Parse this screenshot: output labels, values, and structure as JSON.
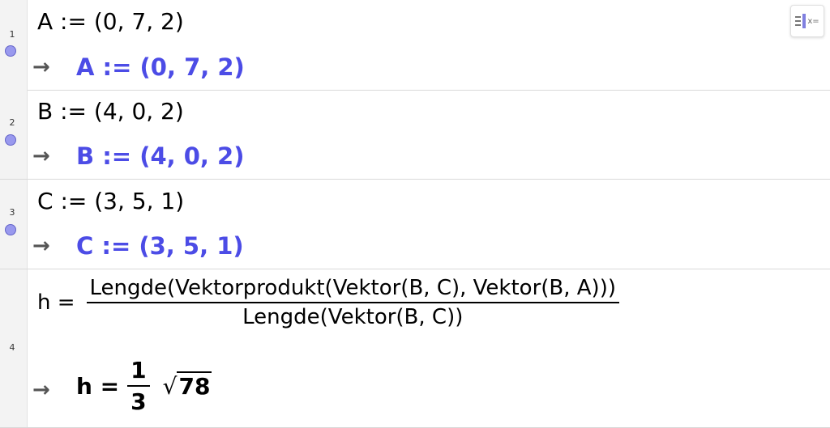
{
  "rows": [
    {
      "number": "1",
      "input": "A := (0, 7, 2)",
      "arrow": "→",
      "output": "A := (0, 7, 2)"
    },
    {
      "number": "2",
      "input": "B := (4, 0, 2)",
      "arrow": "→",
      "output": "B := (4, 0, 2)"
    },
    {
      "number": "3",
      "input": "C := (3, 5, 1)",
      "arrow": "→",
      "output": "C := (3, 5, 1)"
    },
    {
      "number": "4",
      "input_lhs": "h =",
      "input_numerator": "Lengde(Vektorprodukt(Vektor(B, C), Vektor(B, A)))",
      "input_denominator": "Lengde(Vektor(B, C))",
      "arrow": "→",
      "output_lhs": "h =",
      "output_numerator": "1",
      "output_denominator": "3",
      "output_sqrt_symbol": "√",
      "output_radicand": "78"
    }
  ],
  "colors": {
    "output_accent": "#4c4ce6",
    "toggle": "#9999ee"
  },
  "toolbar": {
    "algebra_toggle_icon": "algebra-view-icon",
    "algebra_toggle_label": "x="
  }
}
